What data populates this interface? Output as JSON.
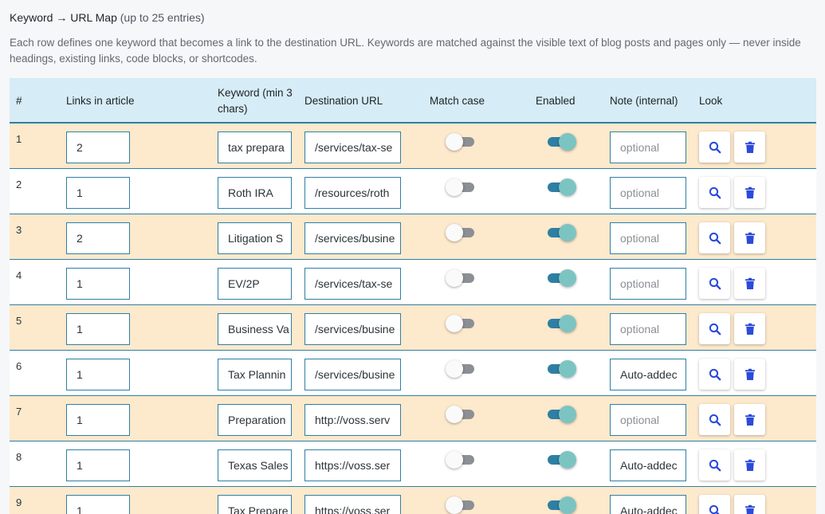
{
  "header": {
    "title": "Keyword → URL Map",
    "title_sub": "(up to 25 entries)",
    "description": "Each row defines one keyword that becomes a link to the destination URL. Keywords are matched against the visible text of blog posts and pages only — never inside headings, existing links, code blocks, or shortcodes."
  },
  "columns": {
    "num": "#",
    "links": "Links in article",
    "keyword": "Keyword (min 3 chars)",
    "url": "Destination URL",
    "match_case": "Match case",
    "enabled": "Enabled",
    "note": "Note (internal)",
    "look": "Look"
  },
  "note_placeholder": "optional",
  "colors": {
    "accent": "#2f7fa4",
    "row_highlight": "#fde9cc",
    "header_bg": "#d6ecf6",
    "toggle_on_knob": "#7cc4c2",
    "action_icon": "#2b4bd8"
  },
  "icons": {
    "look": "search-icon",
    "delete": "trash-icon"
  },
  "rows": [
    {
      "num": "1",
      "links": "2",
      "keyword": "tax prepara",
      "url": "/services/tax-se",
      "match_case": false,
      "enabled": true,
      "note": ""
    },
    {
      "num": "2",
      "links": "1",
      "keyword": "Roth IRA",
      "url": "/resources/roth",
      "match_case": false,
      "enabled": true,
      "note": ""
    },
    {
      "num": "3",
      "links": "2",
      "keyword": "Litigation S",
      "url": "/services/businе",
      "match_case": false,
      "enabled": true,
      "note": ""
    },
    {
      "num": "4",
      "links": "1",
      "keyword": "EV/2P",
      "url": "/services/tax-se",
      "match_case": false,
      "enabled": true,
      "note": ""
    },
    {
      "num": "5",
      "links": "1",
      "keyword": "Business Va",
      "url": "/services/businе",
      "match_case": false,
      "enabled": true,
      "note": ""
    },
    {
      "num": "6",
      "links": "1",
      "keyword": "Tax Plannin",
      "url": "/services/businе",
      "match_case": false,
      "enabled": true,
      "note": "Auto-addec"
    },
    {
      "num": "7",
      "links": "1",
      "keyword": "Preparation",
      "url": "http://voss.serv",
      "match_case": false,
      "enabled": true,
      "note": ""
    },
    {
      "num": "8",
      "links": "1",
      "keyword": "Texas Sales",
      "url": "https://voss.ser",
      "match_case": false,
      "enabled": true,
      "note": "Auto-addec"
    },
    {
      "num": "9",
      "links": "1",
      "keyword": "Tax Prepare",
      "url": "https://voss.ser",
      "match_case": false,
      "enabled": true,
      "note": "Auto-addec"
    }
  ]
}
